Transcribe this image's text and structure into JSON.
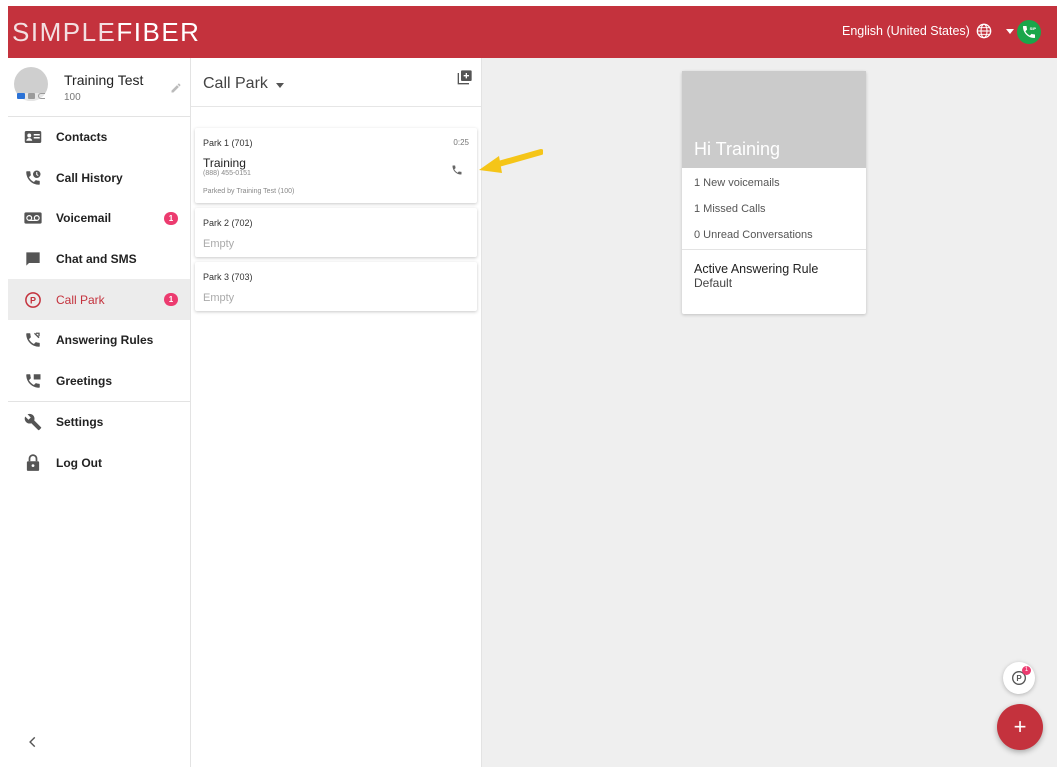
{
  "header": {
    "logo_light": "SIMPLE",
    "logo_bold": "FIBER",
    "language": "English (United States)",
    "sip_label": "SIP"
  },
  "profile": {
    "name": "Training Test",
    "extension": "100"
  },
  "nav": {
    "contacts": "Contacts",
    "call_history": "Call History",
    "voicemail": "Voicemail",
    "voicemail_badge": "1",
    "chat": "Chat and SMS",
    "call_park": "Call Park",
    "call_park_badge": "1",
    "answering_rules": "Answering Rules",
    "greetings": "Greetings",
    "settings": "Settings",
    "logout": "Log Out"
  },
  "panel": {
    "title": "Call Park",
    "parks": [
      {
        "label": "Park 1 (701)",
        "timer": "0:25",
        "caller": "Training",
        "number": "(888) 455-0151",
        "parked_by": "Parked by Training Test (100)"
      },
      {
        "label": "Park 2 (702)",
        "status": "Empty"
      },
      {
        "label": "Park 3 (703)",
        "status": "Empty"
      }
    ]
  },
  "welcome": {
    "greeting": "Hi Training",
    "voicemails": "1 New voicemails",
    "missed": "1 Missed Calls",
    "unread": "0 Unread Conversations",
    "rule_title": "Active Answering Rule",
    "rule_value": "Default"
  },
  "fab": {
    "park_badge": "1",
    "add_label": "+"
  },
  "colors": {
    "brand": "#c4323d",
    "badge": "#ec3b6f",
    "sip_green": "#1aa64a",
    "highlight_arrow": "#f5c518"
  }
}
